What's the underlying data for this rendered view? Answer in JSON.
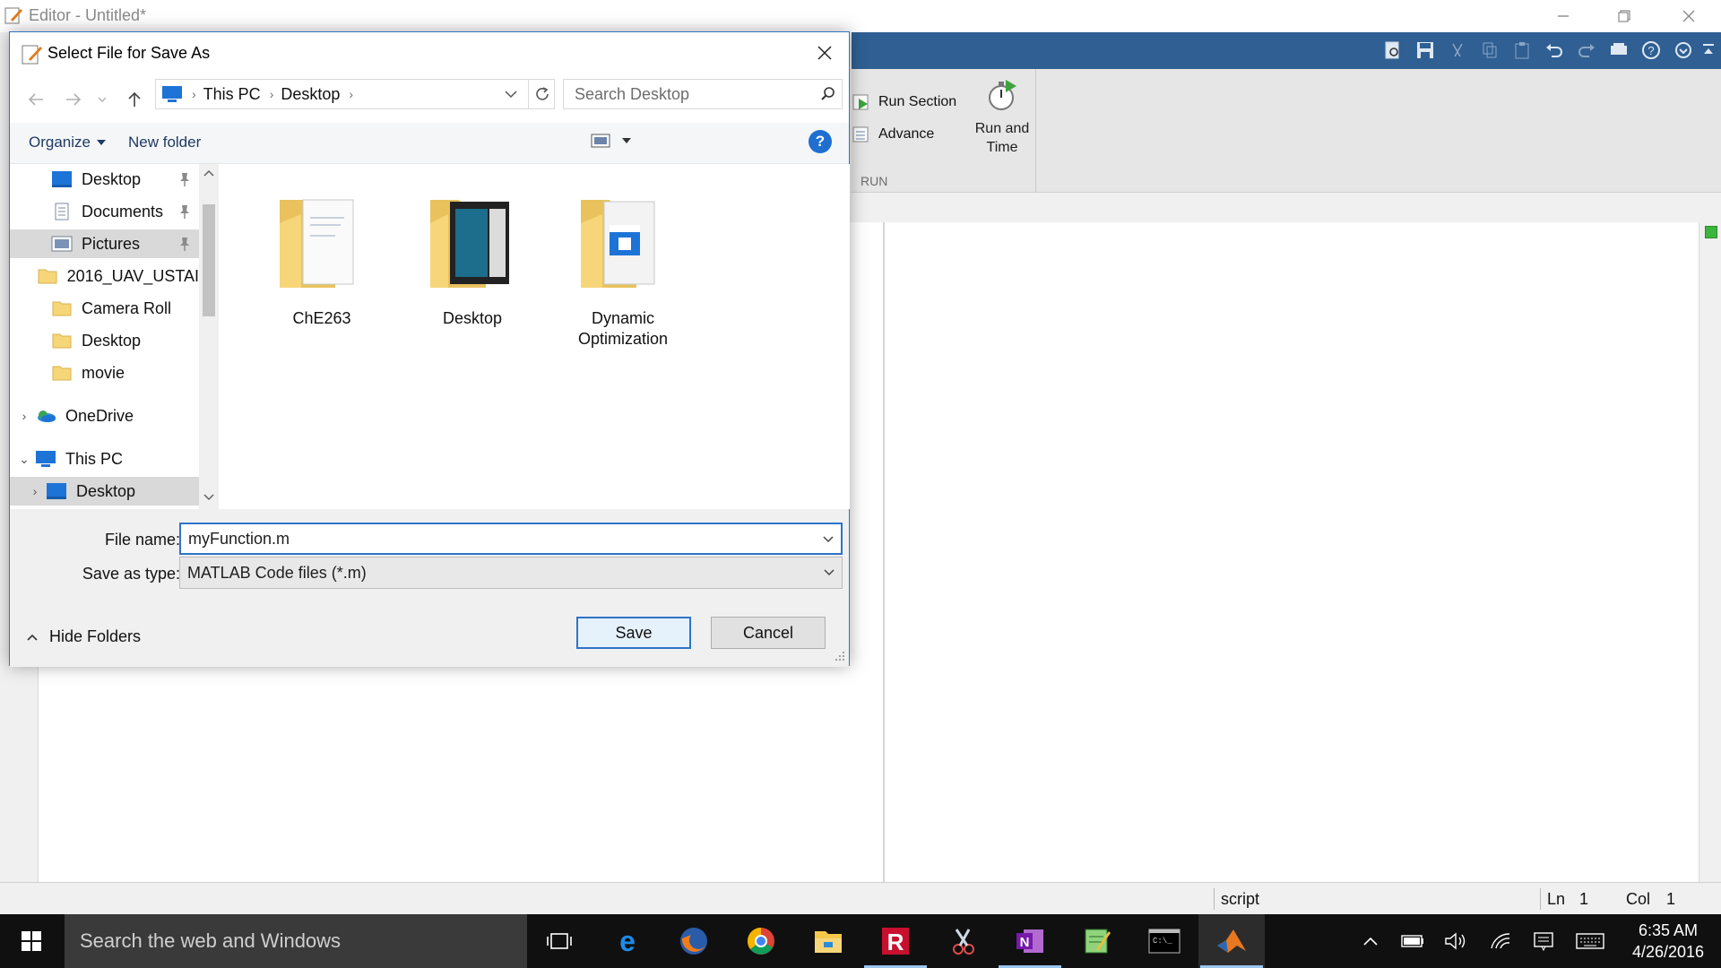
{
  "editor": {
    "title": "Editor - Untitled*",
    "ribbon": {
      "run_section": "Run Section",
      "advance": "Advance",
      "run_and_time_1": "Run and",
      "run_and_time_2": "Time",
      "group_label": "RUN"
    },
    "status": {
      "mode": "script",
      "ln_label": "Ln",
      "ln_value": "1",
      "col_label": "Col",
      "col_value": "1"
    }
  },
  "dialog": {
    "title": "Select File for Save As",
    "address": {
      "root": "This PC",
      "folder": "Desktop"
    },
    "search_placeholder": "Search Desktop",
    "toolbar": {
      "organize": "Organize",
      "new_folder": "New folder",
      "help": "?"
    },
    "nav_items": [
      {
        "label": "Desktop",
        "pinned": true
      },
      {
        "label": "Documents",
        "pinned": true
      },
      {
        "label": "Pictures",
        "pinned": true,
        "selected": true
      },
      {
        "label": "2016_UAV_USTAI"
      },
      {
        "label": "Camera Roll"
      },
      {
        "label": "Desktop"
      },
      {
        "label": "movie"
      },
      {
        "label": "OneDrive"
      },
      {
        "label": "This PC"
      },
      {
        "label": "Desktop"
      }
    ],
    "folders": [
      {
        "line1": "ChE263",
        "line2": ""
      },
      {
        "line1": "Desktop",
        "line2": ""
      },
      {
        "line1": "Dynamic",
        "line2": "Optimization"
      }
    ],
    "file_name_label": "File name:",
    "file_name_value": "myFunction.m",
    "save_type_label": "Save as type:",
    "save_type_value": "MATLAB Code files (*.m)",
    "hide_folders": "Hide Folders",
    "save_button": "Save",
    "cancel_button": "Cancel"
  },
  "taskbar": {
    "search_text": "Search the web and Windows",
    "time": "6:35 AM",
    "date": "4/26/2016"
  },
  "colors": {
    "ribbon_blue": "#2f5f93",
    "accent": "#2e74c9",
    "folder": "#f7d67a"
  }
}
